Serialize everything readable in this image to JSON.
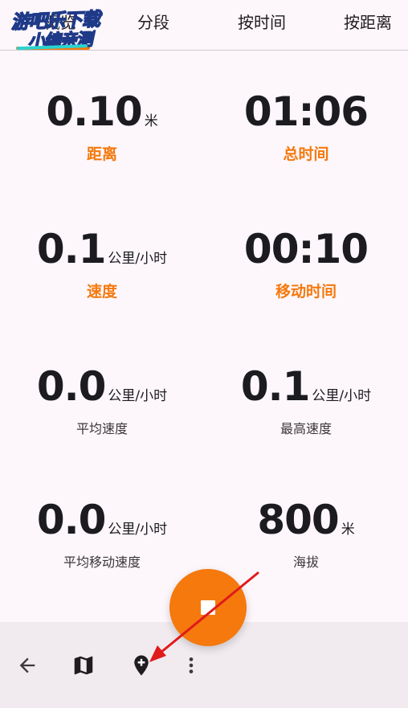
{
  "tabs": [
    {
      "label": "概览"
    },
    {
      "label": "分段"
    },
    {
      "label": "按时间"
    },
    {
      "label": "按距离"
    }
  ],
  "watermark": {
    "line1": "游吧乐下载",
    "line2": "小编亲测"
  },
  "stats": {
    "distance": {
      "value": "0.10",
      "unit": "米",
      "label": "距离"
    },
    "total_time": {
      "value": "01:06",
      "unit": "",
      "label": "总时间"
    },
    "speed": {
      "value": "0.1",
      "unit": "公里/小时",
      "label": "速度"
    },
    "moving_time": {
      "value": "00:10",
      "unit": "",
      "label": "移动时间"
    },
    "avg_speed": {
      "value": "0.0",
      "unit": "公里/小时",
      "label": "平均速度"
    },
    "max_speed": {
      "value": "0.1",
      "unit": "公里/小时",
      "label": "最高速度"
    },
    "avg_moving_speed": {
      "value": "0.0",
      "unit": "公里/小时",
      "label": "平均移动速度"
    },
    "elevation": {
      "value": "800",
      "unit": "米",
      "label": "海拔"
    }
  },
  "colors": {
    "accent": "#f5790d",
    "background": "#fdf7fc",
    "bottom_bar": "#f1ebf0",
    "annotation_arrow": "#e01b1b"
  },
  "icons": {
    "fab": "stop-icon",
    "back": "arrow-back-icon",
    "map": "map-icon",
    "marker": "add-location-icon",
    "more": "more-vert-icon"
  }
}
